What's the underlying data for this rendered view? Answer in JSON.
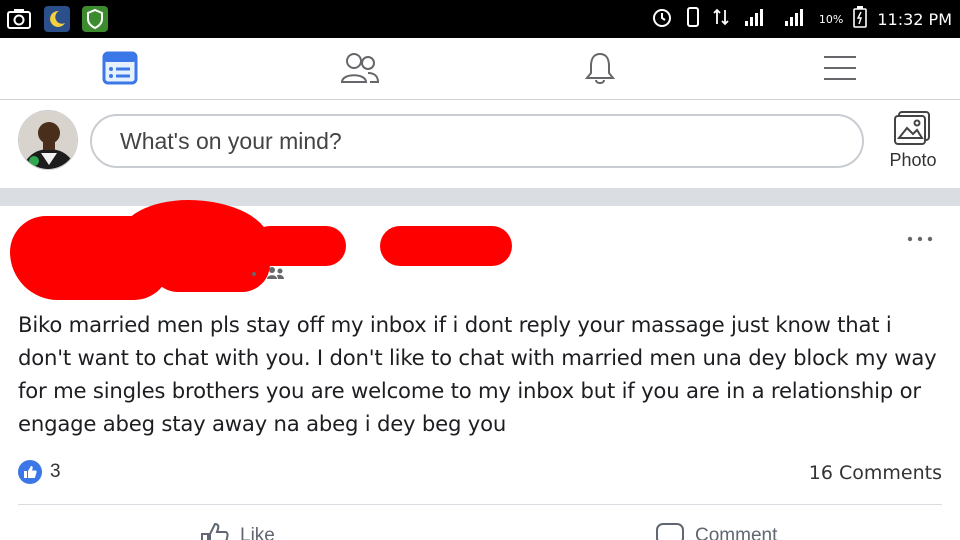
{
  "statusbar": {
    "signal_text": "10%",
    "time": "11:32 PM"
  },
  "nav": {
    "items": [
      "news-feed",
      "friends",
      "notifications",
      "menu"
    ]
  },
  "composer": {
    "placeholder": "What's on your mind?",
    "photo_label": "Photo"
  },
  "post": {
    "text": "Biko married men pls stay off my inbox if i dont reply your massage just know that i don't want to chat with you. I don't like to chat with married men una dey block my way for me singles brothers you are welcome to my inbox but if you are in a relationship or engage abeg stay away na abeg i dey beg you",
    "like_count": "3",
    "comments": "16 Comments",
    "like_label": "Like",
    "comment_label": "Comment"
  },
  "colors": {
    "accent": "#3b77e7",
    "redaction": "#ff0000"
  }
}
